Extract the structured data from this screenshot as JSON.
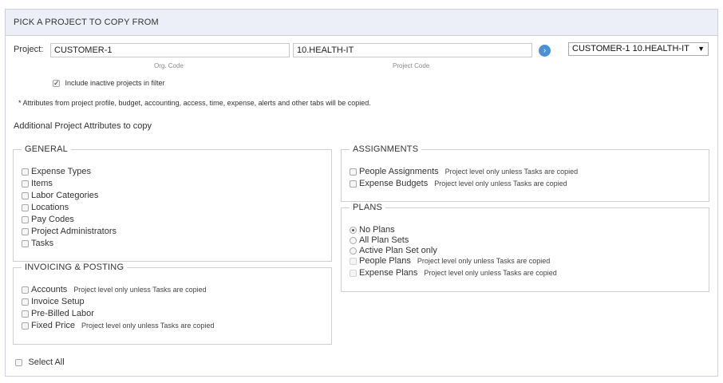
{
  "header": {
    "title": "PICK A PROJECT TO COPY FROM"
  },
  "project": {
    "label": "Project:",
    "org_code_value": "CUSTOMER-1",
    "org_code_caption": "Org. Code",
    "project_code_value": "10.HEALTH-IT",
    "project_code_caption": "Project Code",
    "go_icon": "chevron-right-icon",
    "selected_project": "CUSTOMER-1 10.HEALTH-IT",
    "include_inactive_label": "Include inactive projects in filter",
    "include_inactive_checked": true
  },
  "notes": {
    "attributes_note": "* Attributes from project profile, budget, accounting, access, time, expense, alerts and other tabs will be copied.",
    "additional_heading": "Additional Project Attributes to copy"
  },
  "general": {
    "legend": "GENERAL",
    "items": [
      {
        "label": "Expense Types"
      },
      {
        "label": "Items"
      },
      {
        "label": "Labor Categories"
      },
      {
        "label": "Locations"
      },
      {
        "label": "Pay Codes"
      },
      {
        "label": "Project Administrators"
      },
      {
        "label": "Tasks"
      }
    ]
  },
  "invoicing": {
    "legend": "INVOICING & POSTING",
    "items": [
      {
        "label": "Accounts",
        "note": "Project level only unless Tasks are copied"
      },
      {
        "label": "Invoice Setup",
        "note": ""
      },
      {
        "label": "Pre-Billed Labor",
        "note": ""
      },
      {
        "label": "Fixed Price",
        "note": "Project level only unless Tasks are copied"
      }
    ]
  },
  "assignments": {
    "legend": "ASSIGNMENTS",
    "items": [
      {
        "label": "People Assignments",
        "note": "Project level only unless Tasks are copied"
      },
      {
        "label": "Expense Budgets",
        "note": "Project level only unless Tasks are copied"
      }
    ]
  },
  "plans": {
    "legend": "PLANS",
    "radios": [
      {
        "label": "No Plans",
        "checked": true
      },
      {
        "label": "All Plan Sets",
        "checked": false
      },
      {
        "label": "Active Plan Set only",
        "checked": false
      }
    ],
    "items": [
      {
        "label": "People Plans",
        "note": "Project level only unless Tasks are copied"
      },
      {
        "label": "Expense Plans",
        "note": "Project level only unless Tasks are copied"
      }
    ]
  },
  "footer": {
    "select_all_label": "Select All"
  },
  "colors": {
    "header_bg": "#eceef8",
    "accent": "#4a90d9",
    "border": "#cfcfcf"
  }
}
